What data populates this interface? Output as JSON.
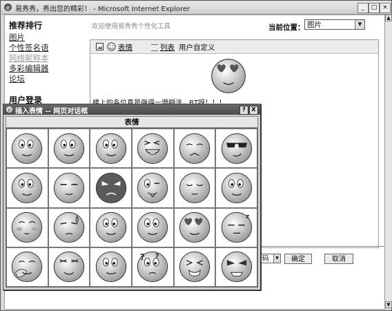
{
  "window": {
    "title": "易秀秀，秀出您的精彩！ - Microsoft Internet Explorer"
  },
  "sidebar": {
    "title": "推荐排行",
    "items": [
      {
        "label": "图片",
        "dim": false
      },
      {
        "label": "个性签名语",
        "dim": false
      },
      {
        "label": "网络昵称本",
        "dim": true
      },
      {
        "label": "多彩编辑器",
        "dim": false
      },
      {
        "label": "论坛",
        "dim": false
      }
    ],
    "login_title": "用户登录"
  },
  "header": {
    "welcome": "欢迎使用易秀秀个性化工具",
    "location_label": "当前位置：",
    "location_value": "图片"
  },
  "editor": {
    "toolbar": {
      "emoticon": "表情",
      "list": "列表",
      "custom": "用户自定义"
    },
    "post_text": "楼上的各位真是强得一塌糊涂，BT呀！！！"
  },
  "footer": {
    "select_value": "码",
    "ok_label": "确定",
    "cancel_label": "取消"
  },
  "dialog": {
    "title": "插入表情 -- 网页对话框",
    "help": "?",
    "close": "X",
    "header": "表情",
    "emoticons": [
      "worried",
      "silly",
      "goofy",
      "laugh",
      "shy",
      "cool",
      "pensive",
      "drool",
      "angry",
      "tongue",
      "sleepy",
      "surprised",
      "blush",
      "sweat",
      "confused",
      "awkward",
      "love",
      "snore",
      "hide",
      "squint",
      "smile",
      "question",
      "grimace",
      "furious"
    ]
  }
}
